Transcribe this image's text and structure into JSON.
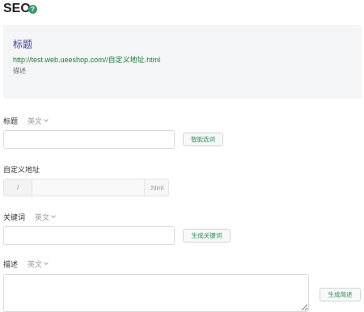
{
  "header": {
    "title": "SEO",
    "help_icon": "question-circle-icon",
    "help_glyph": "?"
  },
  "preview": {
    "title": "标题",
    "url": "http://test.web.ueeshop.com//自定义地址.html",
    "description": "描述"
  },
  "fields": {
    "title": {
      "label": "标题",
      "language": "英文",
      "value": "",
      "button": "智能选词"
    },
    "custom_url": {
      "label": "自定义地址",
      "prefix": "/",
      "value": "",
      "suffix": ".html"
    },
    "keywords": {
      "label": "关键词",
      "language": "英文",
      "value": "",
      "button": "生成关键词"
    },
    "description": {
      "label": "描述",
      "language": "英文",
      "value": "",
      "button": "生成简述"
    }
  },
  "colors": {
    "accent": "#2e8b57",
    "preview_title": "#3b3b9b",
    "preview_url": "#1e7a35",
    "preview_bg": "#f4f5f7"
  }
}
